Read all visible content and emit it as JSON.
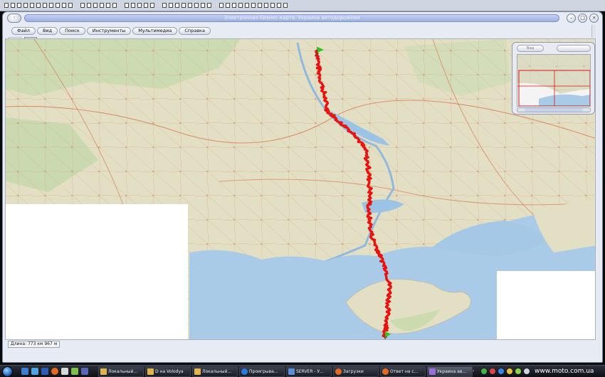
{
  "window": {
    "title": "Электронная бизнес-карта. Украина автодорожная",
    "sys_button": "◦",
    "minimize": "–",
    "maximize": "□",
    "close": "×"
  },
  "menu": [
    {
      "label": "Файл"
    },
    {
      "label": "Вид"
    },
    {
      "label": "Поиск"
    },
    {
      "label": "Инструменты"
    },
    {
      "label": "Мультимедиа"
    },
    {
      "label": "Справка"
    }
  ],
  "toolbar": {
    "tools": [
      {
        "icon": "eraser-icon"
      },
      {
        "icon": "eye-icon"
      }
    ]
  },
  "overview": {
    "left_button": "Вид",
    "right_button": ""
  },
  "statusbar": {
    "length": "Длина: 773 км 967 м"
  },
  "taskbar": {
    "tasks": [
      {
        "label": "Локальный..."
      },
      {
        "label": "D на Volodya"
      },
      {
        "label": "Локальный..."
      },
      {
        "label": "Проигрыва..."
      },
      {
        "label": "SERVER - У..."
      },
      {
        "label": "Загрузки"
      },
      {
        "label": "Ответ на с..."
      },
      {
        "label": "Украина ав..."
      }
    ],
    "watermark": "www.moto.com.ua"
  },
  "colors": {
    "route": "#e8130f",
    "sea": "#a9cbe7",
    "land": "#e3dfc4",
    "forest": "#b9d6a1"
  }
}
